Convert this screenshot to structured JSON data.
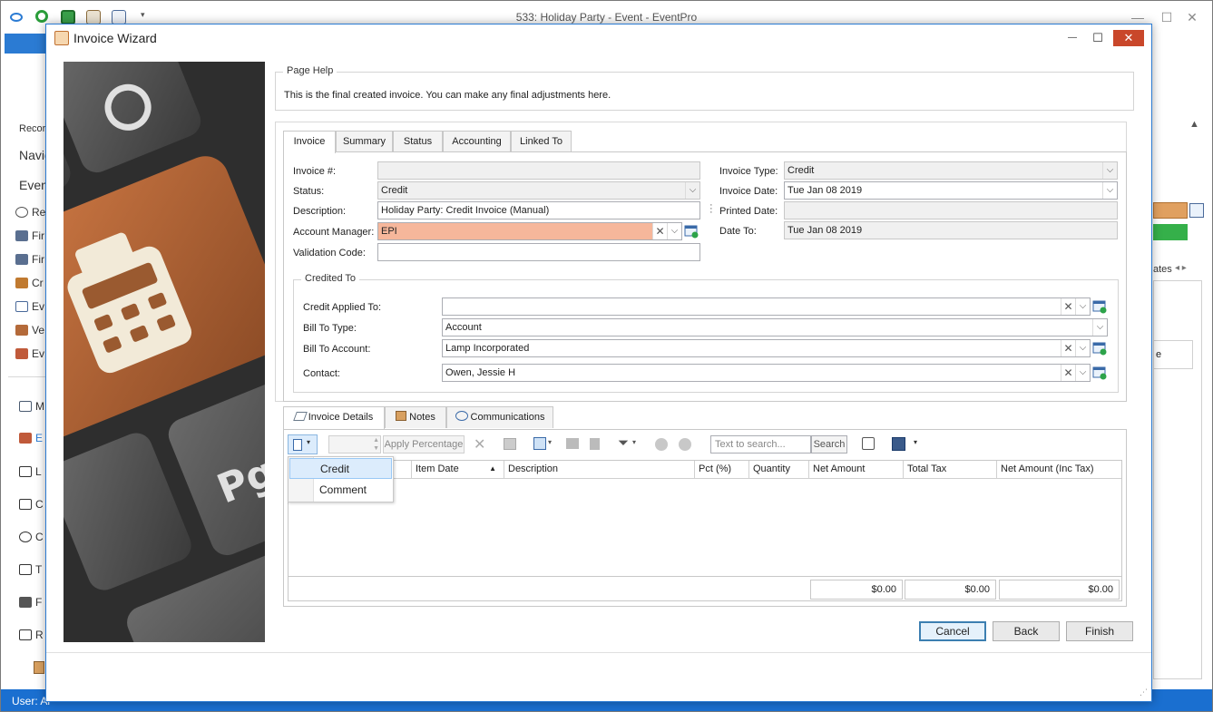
{
  "app": {
    "title": "533: Holiday Party - Event - EventPro",
    "left_items": [
      "Recor",
      "Navig",
      "Event",
      "Re",
      "Fir",
      "Fir",
      "Cr",
      "Ev",
      "Ve",
      "Ev",
      "M",
      "E",
      "L",
      "C",
      "C",
      "T",
      "F",
      "R"
    ],
    "right_fragment_1": "ates",
    "right_fragment_2": "e",
    "status": "User: Al"
  },
  "dialog": {
    "title": "Invoice Wizard",
    "close_glyph": "✕",
    "minimize_glyph": "—",
    "maximize_glyph": "☐"
  },
  "page_help": {
    "legend": "Page Help",
    "text": "This is the final created invoice.  You can make any final adjustments here."
  },
  "main_tabs": [
    {
      "label": "Invoice"
    },
    {
      "label": "Summary"
    },
    {
      "label": "Status"
    },
    {
      "label": "Accounting"
    },
    {
      "label": "Linked To"
    }
  ],
  "invoice_tab": {
    "invoice_number_label": "Invoice #:",
    "invoice_number_value": "",
    "status_label": "Status:",
    "status_value": "Credit",
    "description_label": "Description:",
    "description_value": "Holiday Party: Credit Invoice (Manual)",
    "account_manager_label": "Account Manager:",
    "account_manager_value": "EPI",
    "validation_code_label": "Validation Code:",
    "validation_code_value": "",
    "invoice_type_label": "Invoice Type:",
    "invoice_type_value": "Credit",
    "invoice_date_label": "Invoice Date:",
    "invoice_date_value": "Tue Jan 08 2019",
    "printed_date_label": "Printed Date:",
    "printed_date_value": "",
    "date_to_label": "Date To:",
    "date_to_value": "Tue Jan 08 2019"
  },
  "credited_to": {
    "legend": "Credited To",
    "credit_applied_to_label": "Credit Applied To:",
    "credit_applied_to_value": "",
    "bill_to_type_label": "Bill To Type:",
    "bill_to_type_value": "Account",
    "bill_to_account_label": "Bill To Account:",
    "bill_to_account_value": "Lamp Incorporated",
    "contact_label": "Contact:",
    "contact_value": "Owen, Jessie H"
  },
  "details_tabs": [
    {
      "label": "Invoice Details"
    },
    {
      "label": "Notes"
    },
    {
      "label": "Communications"
    }
  ],
  "toolbar": {
    "percentage_value": "",
    "apply_percentage_label": "Apply Percentage",
    "search_placeholder": "Text to search...",
    "search_button": "Search"
  },
  "grid": {
    "columns": [
      "Item Date",
      "Description",
      "Pct (%)",
      "Quantity",
      "Net Amount",
      "Total Tax",
      "Net Amount (Inc Tax)"
    ],
    "totals": [
      "$0.00",
      "$0.00",
      "$0.00"
    ]
  },
  "add_menu": {
    "items": [
      "Credit",
      "Comment"
    ]
  },
  "buttons": {
    "cancel": "Cancel",
    "back": "Back",
    "finish": "Finish"
  },
  "colors": {
    "accent": "#2b7bd3",
    "required_field": "#f6b79b",
    "close_button": "#c9472a",
    "status_bar": "#1a6fd0"
  }
}
